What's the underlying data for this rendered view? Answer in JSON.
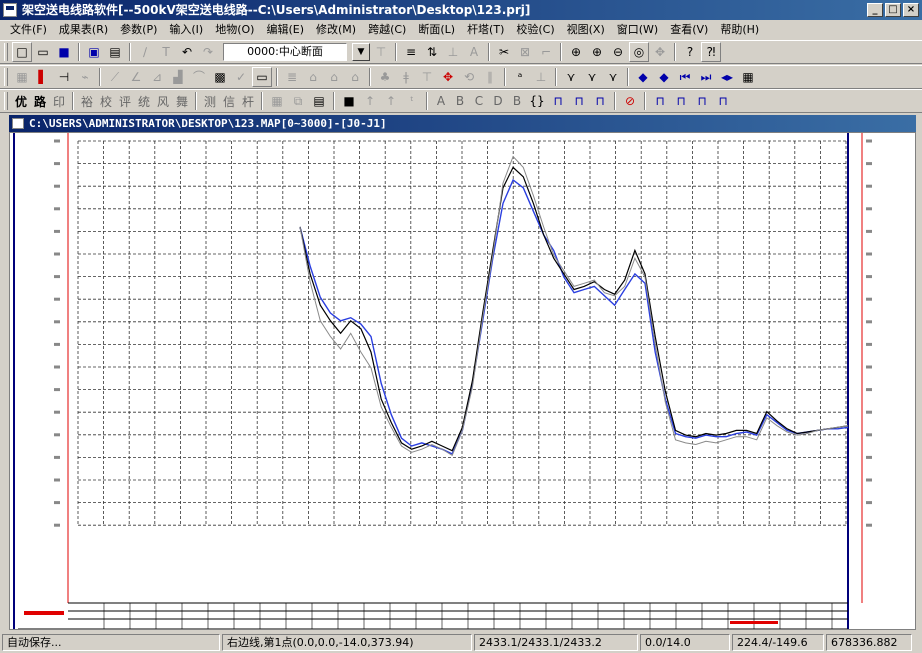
{
  "window": {
    "title": "架空送电线路软件[--500kV架空送电线路--C:\\Users\\Administrator\\Desktop\\123.prj]"
  },
  "window_buttons": {
    "minimize": "_",
    "maximize": "□",
    "close": "×"
  },
  "menu": [
    "文件(F)",
    "成果表(R)",
    "参数(P)",
    "输入(I)",
    "地物(O)",
    "编辑(E)",
    "修改(M)",
    "跨越(C)",
    "断面(L)",
    "杆塔(T)",
    "校验(C)",
    "视图(X)",
    "窗口(W)",
    "查看(V)",
    "帮助(H)"
  ],
  "toolbar1": {
    "section_value": "0000:中心断面"
  },
  "toolbar3": {
    "chars": [
      "优",
      "路",
      "印",
      "裕",
      "校",
      "评",
      "统",
      "风",
      "舞",
      "测",
      "信",
      "杆"
    ],
    "letters": [
      "A",
      "B",
      "C",
      "D",
      "B"
    ]
  },
  "document": {
    "title": "C:\\USERS\\ADMINISTRATOR\\DESKTOP\\123.MAP[0~3000]-[J0-J1]"
  },
  "status": {
    "autosave": "自动保存...",
    "right_line": "右边线,第1点(0.0,0.0,-14.0,373.94)",
    "coords": "2433.1/2433.1/2433.2",
    "offset": "0.0/14.0",
    "position": "224.4/-149.6",
    "total": "678336.882"
  },
  "colors": {
    "blue_line": "#2b3fe0",
    "black_line": "#000000",
    "gray_line": "#8a8a8a",
    "border_red": "#e00000",
    "border_navy": "#00007a"
  },
  "chart_data": {
    "type": "line",
    "x": [
      0,
      20,
      40,
      60,
      80,
      100,
      120,
      140,
      160,
      180,
      200,
      220,
      240,
      260,
      280,
      300,
      320,
      340,
      360,
      380,
      400,
      420,
      440,
      460,
      480,
      500,
      520,
      540,
      560,
      580,
      600,
      620,
      640,
      660,
      680,
      700,
      720,
      740,
      760,
      780,
      800,
      820,
      840,
      860,
      880,
      900,
      920,
      940,
      960,
      980,
      1000,
      1020,
      1040,
      1060,
      1080
    ],
    "series": [
      {
        "values": [
          230,
          205,
          185,
          175,
          170,
          172,
          168,
          160,
          130,
          110,
          95,
          90,
          92,
          90,
          88,
          85,
          100,
          130,
          170,
          210,
          245,
          260,
          255,
          240,
          225,
          215,
          198,
          188,
          190,
          192,
          186,
          180,
          190,
          200,
          194,
          150,
          120,
          98,
          96,
          95,
          97,
          96,
          96,
          98,
          99,
          97,
          110,
          105,
          100,
          98,
          99,
          100,
          101,
          101,
          102
        ]
      },
      {
        "values": [
          230,
          200,
          180,
          170,
          162,
          170,
          165,
          150,
          120,
          105,
          92,
          88,
          90,
          93,
          90,
          87,
          102,
          132,
          175,
          215,
          255,
          268,
          262,
          245,
          225,
          210,
          200,
          190,
          192,
          195,
          190,
          187,
          196,
          215,
          200,
          160,
          125,
          100,
          97,
          96,
          98,
          97,
          98,
          100,
          100,
          98,
          112,
          106,
          101,
          98,
          99,
          100,
          101,
          102,
          103
        ]
      },
      {
        "values": [
          230,
          195,
          170,
          160,
          152,
          162,
          150,
          140,
          115,
          102,
          90,
          86,
          88,
          91,
          88,
          84,
          100,
          128,
          172,
          212,
          258,
          275,
          268,
          250,
          230,
          212,
          202,
          192,
          194,
          196,
          188,
          186,
          192,
          210,
          198,
          155,
          118,
          94,
          92,
          91,
          93,
          92,
          94,
          96,
          96,
          94,
          108,
          103,
          99,
          97,
          98,
          100,
          101,
          102,
          103
        ]
      }
    ]
  }
}
